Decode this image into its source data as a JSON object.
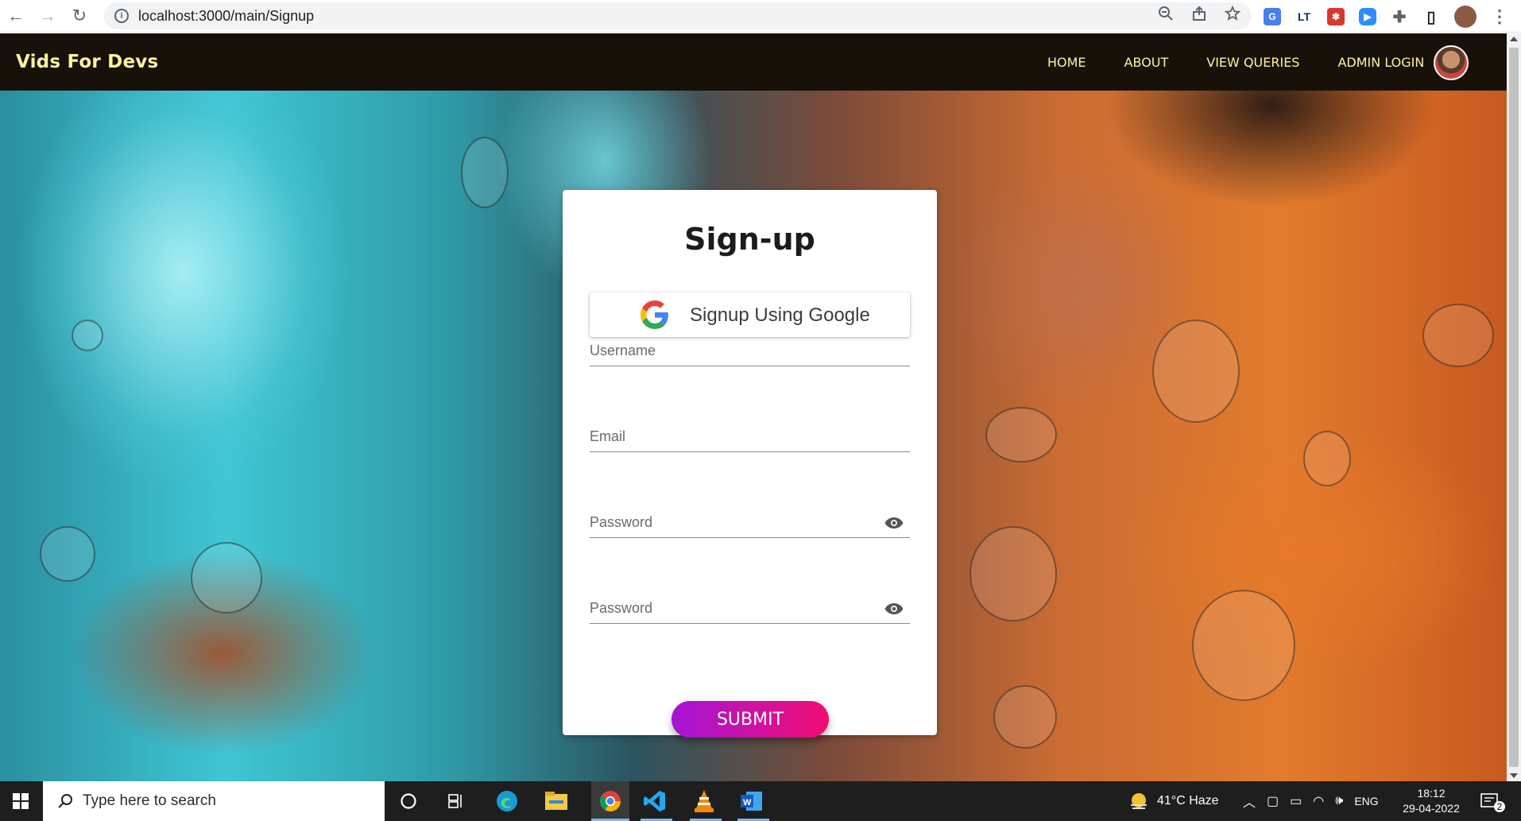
{
  "browser": {
    "url": "localhost:3000/main/Signup",
    "nav": {
      "back": "←",
      "forward": "→",
      "reload": "↻"
    },
    "omni_icons": [
      "zoom-icon",
      "share-icon",
      "star-icon"
    ],
    "extensions": [
      "translate-icon",
      "lt-icon",
      "bug-icon",
      "zoom-app-icon",
      "puzzle-icon",
      "side-panel-icon",
      "profile-icon",
      "menu-icon"
    ],
    "ext_labels": {
      "lt": "LT"
    }
  },
  "app": {
    "brand": "Vids For Devs",
    "nav_links": [
      "HOME",
      "ABOUT",
      "VIEW QUERIES",
      "ADMIN LOGIN"
    ]
  },
  "signup": {
    "title": "Sign-up",
    "google_button": "Signup Using Google",
    "fields": {
      "username": "Username",
      "email": "Email",
      "password": "Password",
      "confirm_password": "Password"
    },
    "submit": "SUBMIT"
  },
  "taskbar": {
    "search_placeholder": "Type here to search",
    "weather": "41°C  Haze",
    "lang": "ENG",
    "time": "18:12",
    "date": "29-04-2022",
    "notification_count": "2"
  },
  "colors": {
    "appbar_bg": "#17110a",
    "appbar_text": "#fcf39a",
    "submit_gradient_start": "#a515d6",
    "submit_gradient_end": "#f10e74"
  }
}
